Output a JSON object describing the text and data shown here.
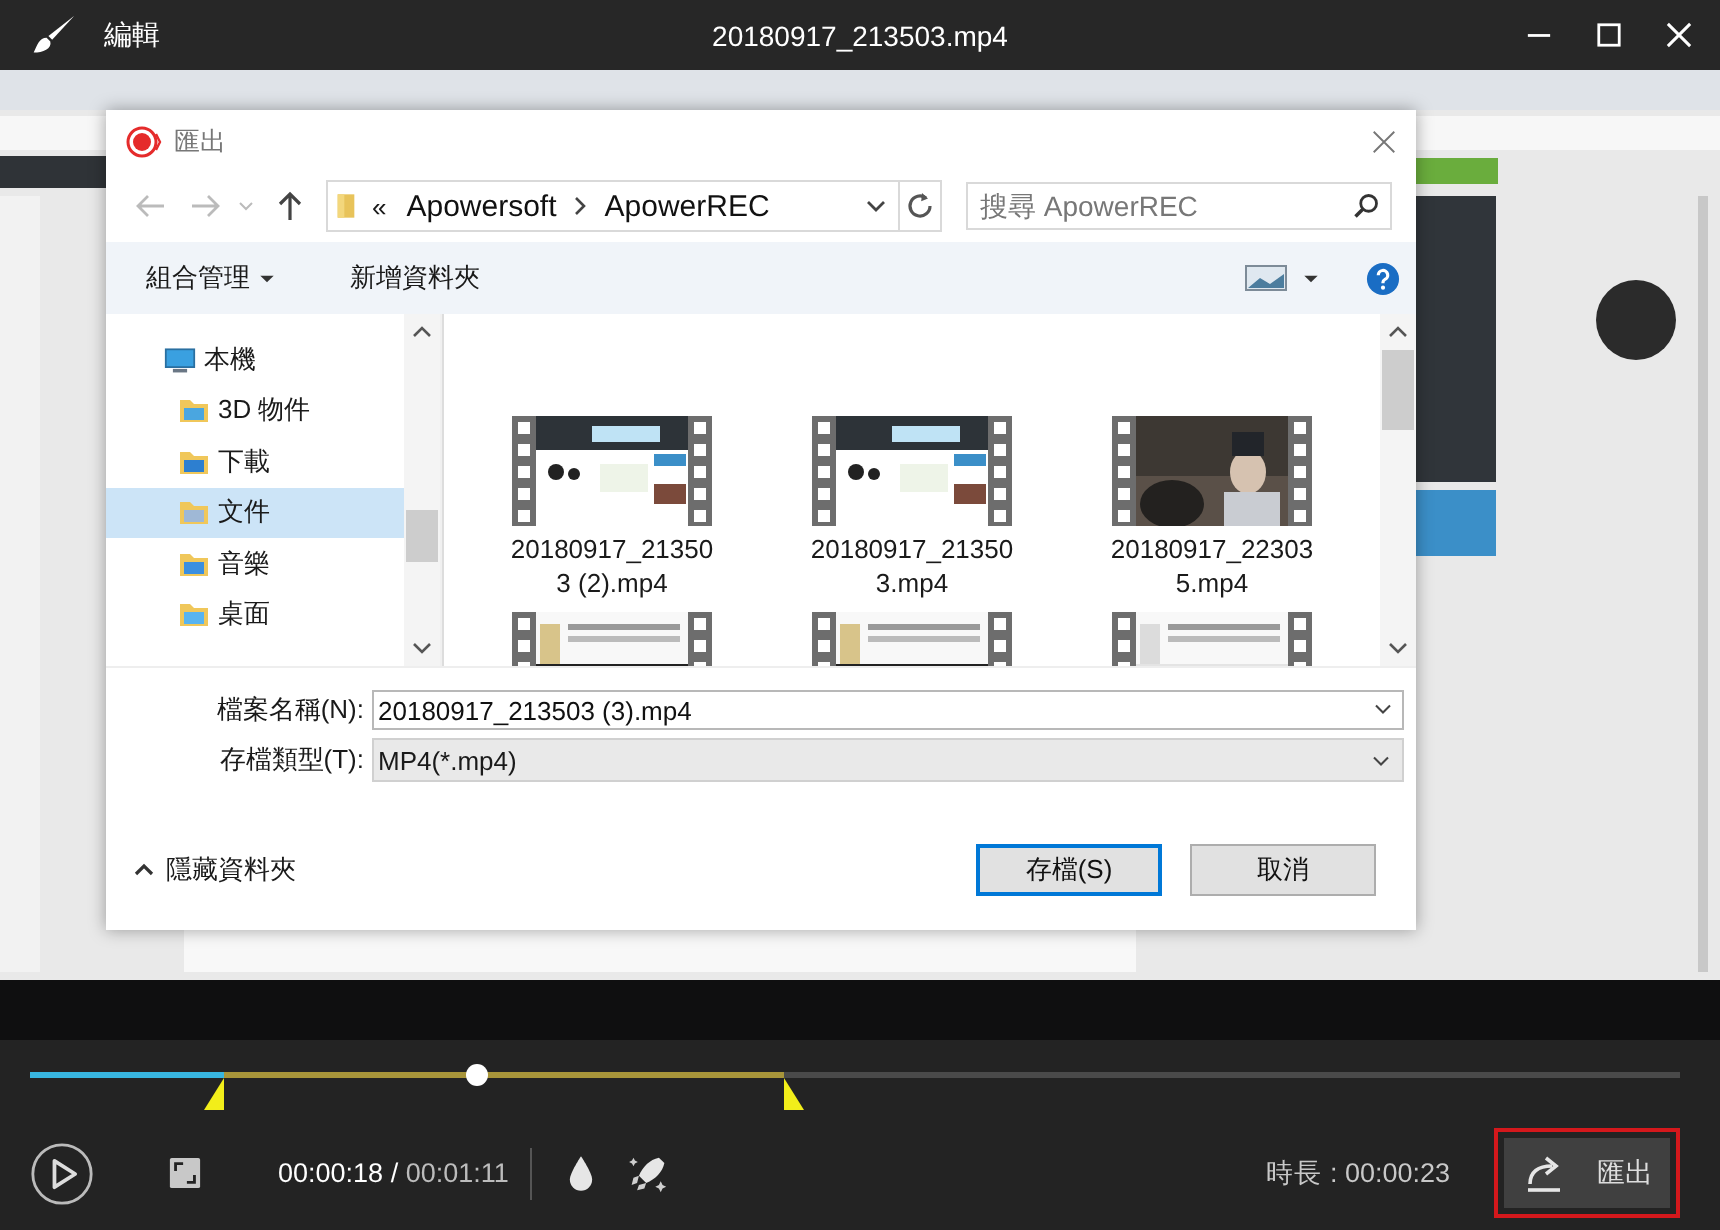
{
  "window": {
    "mode": "編輯",
    "title": "20180917_213503.mp4"
  },
  "video": {
    "kind": "picture"
  },
  "dialog": {
    "title": "匯出",
    "path": {
      "overflow": "«",
      "folders": [
        "Apowersoft",
        "ApowerREC"
      ]
    },
    "search": {
      "placeholder": "搜尋 ApowerREC"
    },
    "toolbar": [
      {
        "label": "組合管理",
        "menu": true
      },
      {
        "label": "新增資料夾",
        "menu": false
      }
    ],
    "nav": [
      {
        "label": "本機",
        "selected": false,
        "children": [
          {
            "label": "3D 物件",
            "selected": false
          },
          {
            "label": "下載",
            "selected": false
          },
          {
            "label": "文件",
            "selected": true
          },
          {
            "label": "音樂",
            "selected": false
          },
          {
            "label": "桌面",
            "selected": false
          }
        ]
      }
    ],
    "files": [
      {
        "kind": "picture",
        "name": "20180917_213503 (2).mp4"
      },
      {
        "kind": "picture",
        "name": "20180917_213503.mp4"
      },
      {
        "kind": "picture",
        "name": "20180917_223035.mp4"
      },
      {
        "kind": "picture"
      },
      {
        "kind": "picture"
      },
      {
        "kind": "picture"
      }
    ],
    "filename": {
      "label": "檔案名稱(N):",
      "value": "20180917_213503 (3).mp4"
    },
    "filetype": {
      "label": "存檔類型(T):",
      "value": "MP4(*.mp4)"
    },
    "hide_folders": "隱藏資料夾",
    "buttons": [
      {
        "label": "存檔(S)",
        "default": true
      },
      {
        "label": "取消",
        "default": false
      }
    ]
  },
  "player": {
    "timeline": {
      "level": 0.27,
      "trim_start": {
        "level": 0.118
      },
      "trim_end": {
        "level": 0.457
      }
    },
    "current": "00:00:18",
    "separator": "/",
    "total": "00:01:11",
    "duration": "時長 : 00:00:23",
    "export": {
      "label": "匯出",
      "outlined": true
    }
  }
}
